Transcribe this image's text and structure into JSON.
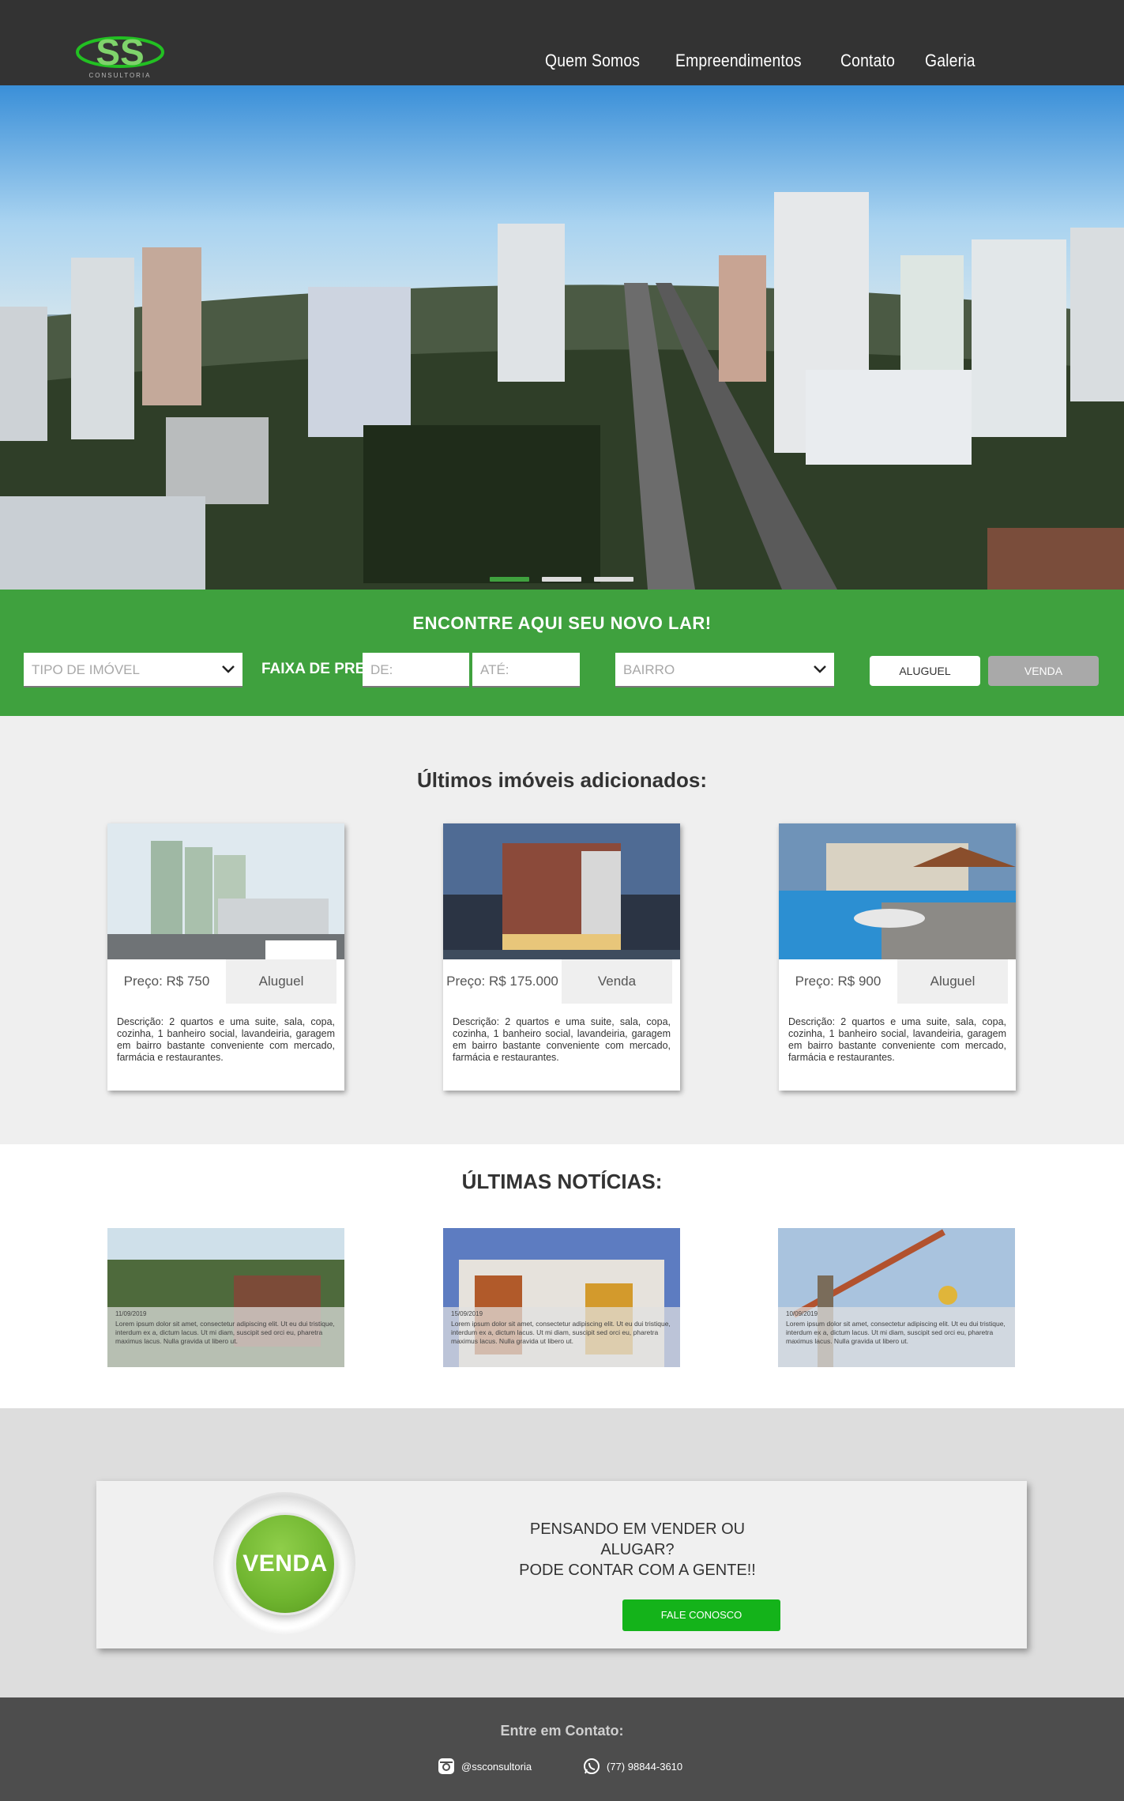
{
  "header": {
    "logo_text": "SS",
    "logo_sub": "CONSULTORIA",
    "nav": [
      "Quem Somos",
      "Empreendimentos",
      "Contato",
      "Galeria"
    ]
  },
  "search": {
    "title": "ENCONTRE AQUI SEU NOVO LAR!",
    "tipo_placeholder": "TIPO DE IMÓVEL",
    "price_label": "FAIXA DE PREÇO:",
    "de_placeholder": "DE:",
    "ate_placeholder": "ATÉ:",
    "bairro_placeholder": "BAIRRO",
    "btn_aluguel": "ALUGUEL",
    "btn_venda": "VENDA"
  },
  "listings": {
    "title": "Últimos imóveis adicionados:",
    "items": [
      {
        "price": "Preço: R$ 750",
        "type": "Aluguel",
        "desc": "Descrição: 2 quartos e uma suite, sala, copa, cozinha, 1 banheiro social, lavandeiria, garagem em bairro bastante conveniente com mercado, farmácia e restaurantes."
      },
      {
        "price": "Preço: R$ 175.000",
        "type": "Venda",
        "desc": "Descrição: 2 quartos e uma suite, sala, copa, cozinha, 1 banheiro social, lavandeiria, garagem em bairro bastante conveniente com mercado, farmácia e restaurantes."
      },
      {
        "price": "Preço: R$ 900",
        "type": "Aluguel",
        "desc": "Descrição: 2 quartos e uma suite, sala, copa, cozinha, 1 banheiro social, lavandeiria, garagem em bairro bastante conveniente com mercado, farmácia e restaurantes."
      }
    ]
  },
  "news": {
    "title": "ÚLTIMAS NOTÍCIAS:",
    "items": [
      {
        "date": "11/09/2019",
        "text": "Lorem ipsum dolor sit amet, consectetur adipiscing elit. Ut eu dui tristique, interdum ex a, dictum lacus. Ut mi diam, suscipit sed orci eu, pharetra maximus lacus. Nulla gravida ut libero ut."
      },
      {
        "date": "15/09/2019",
        "text": "Lorem ipsum dolor sit amet, consectetur adipiscing elit. Ut eu dui tristique, interdum ex a, dictum lacus. Ut mi diam, suscipit sed orci eu, pharetra maximus lacus. Nulla gravida ut libero ut."
      },
      {
        "date": "10/09/2019",
        "text": "Lorem ipsum dolor sit amet, consectetur adipiscing elit. Ut eu dui tristique, interdum ex a, dictum lacus. Ut mi diam, suscipit sed orci eu, pharetra maximus lacus. Nulla gravida ut libero ut."
      }
    ]
  },
  "cta": {
    "badge": "VENDA",
    "line1": "PENSANDO EM VENDER OU ALUGAR?",
    "line2": "PODE CONTAR COM A GENTE!!",
    "button": "FALE CONOSCO"
  },
  "footer": {
    "title": "Entre em Contato:",
    "instagram": "@ssconsultoria",
    "phone": "(77) 98844-3610"
  },
  "colors": {
    "green": "#3fa13e",
    "dark": "#333333",
    "cta_button": "#14b31a"
  }
}
